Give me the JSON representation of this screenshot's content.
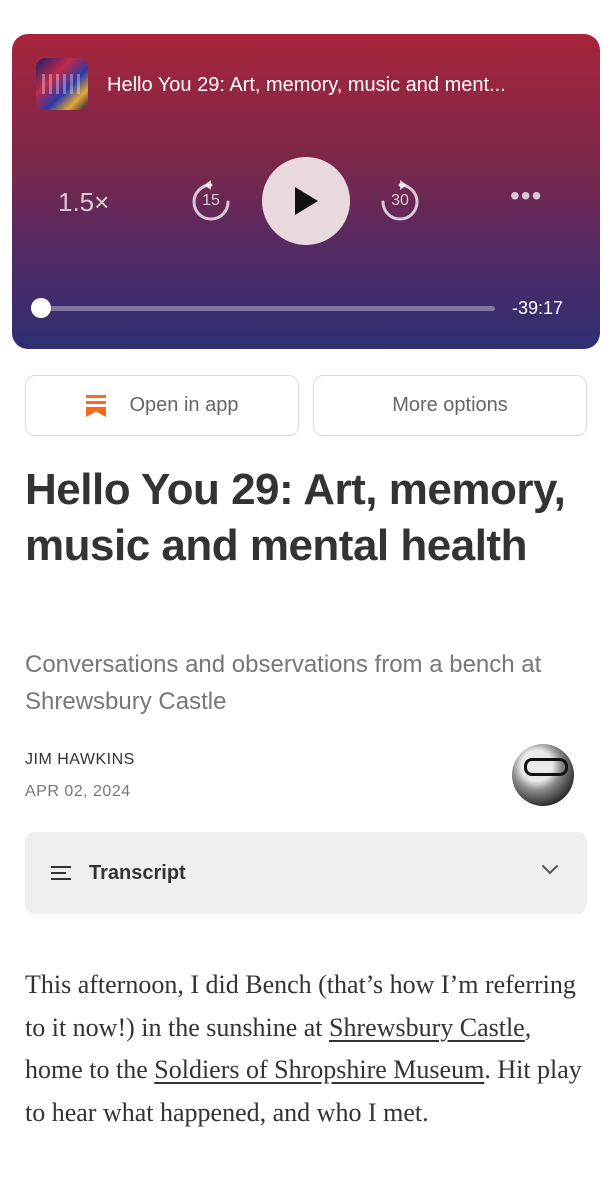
{
  "player": {
    "episode_title": "Hello You 29: Art, memory, music and ment...",
    "speed": "1.5×",
    "skip_back": "15",
    "skip_forward": "30",
    "remaining_time": "-39:17",
    "progress": 0.01,
    "icons": [
      "cover-art",
      "skip-back-icon",
      "play-icon",
      "skip-forward-icon",
      "more-icon"
    ]
  },
  "actions": {
    "open_in_app": "Open in app",
    "more_options": "More options",
    "brand_color": "#ff6719"
  },
  "post": {
    "title": "Hello You 29: Art, memory, music and mental health",
    "subtitle": "Conversations and observations from a bench at Shrewsbury Castle",
    "author": "JIM HAWKINS",
    "date": "APR 02, 2024"
  },
  "transcript": {
    "label": "Transcript"
  },
  "body": {
    "part1": "This afternoon, I did Bench (that’s how I’m referring to it now!) in the sunshine at ",
    "link1": "Shrewsbury Castle",
    "part2": ", home to the ",
    "link2": "Soldiers of Shropshire Museum",
    "part3": ". Hit play to hear what happened, and who I met."
  }
}
